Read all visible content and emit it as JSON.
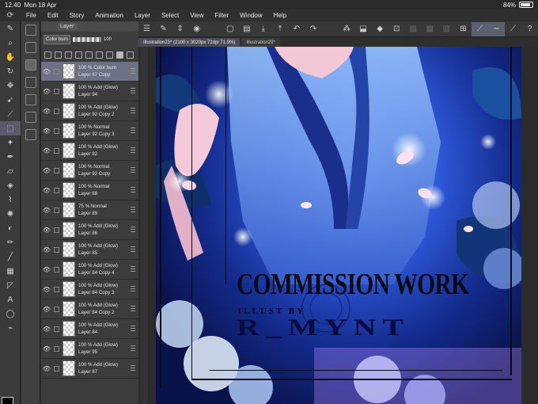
{
  "status_bar": {
    "time": "12.40",
    "date": "Mon 18 Apr",
    "battery": "84%",
    "battery_level": 0.84
  },
  "menu": [
    "File",
    "Edit",
    "Story",
    "Animation",
    "Layer",
    "Select",
    "View",
    "Filter",
    "Window",
    "Help"
  ],
  "layer_panel": {
    "tab_label": "Layer",
    "blend_mode": "Color burn",
    "opacity": "100",
    "layers": [
      {
        "opacity": "100 %",
        "mode": "Color burn",
        "name": "Layer 67 Copy",
        "selected": true
      },
      {
        "opacity": "100 %",
        "mode": "Add (Glow)",
        "name": "Layer 94"
      },
      {
        "opacity": "100 %",
        "mode": "Add (Glow)",
        "name": "Layer 92 Copy 2"
      },
      {
        "opacity": "100 %",
        "mode": "Normal",
        "name": "Layer 92 Copy 3"
      },
      {
        "opacity": "100 %",
        "mode": "Add (Glow)",
        "name": "Layer 92"
      },
      {
        "opacity": "100 %",
        "mode": "Normal",
        "name": "Layer 92 Copy"
      },
      {
        "opacity": "100 %",
        "mode": "Normal",
        "name": "Layer 88"
      },
      {
        "opacity": "75 %",
        "mode": "Normal",
        "name": "Layer 89"
      },
      {
        "opacity": "100 %",
        "mode": "Add (Glow)",
        "name": "Layer 86"
      },
      {
        "opacity": "100 %",
        "mode": "Add (Glow)",
        "name": "Layer 85"
      },
      {
        "opacity": "100 %",
        "mode": "Add (Glow)",
        "name": "Layer 84 Copy 4"
      },
      {
        "opacity": "100 %",
        "mode": "Add (Glow)",
        "name": "Layer 84 Copy 3"
      },
      {
        "opacity": "100 %",
        "mode": "Add (Glow)",
        "name": "Layer 84 Copy 2"
      },
      {
        "opacity": "100 %",
        "mode": "Add (Glow)",
        "name": "Layer 84"
      },
      {
        "opacity": "100 %",
        "mode": "Add (Glow)",
        "name": "Layer 95"
      },
      {
        "opacity": "100 %",
        "mode": "Add (Glow)",
        "name": "Layer 87"
      }
    ]
  },
  "tabs": [
    {
      "label": "Illustration23* (2100 x 3020px 72dpi 71.9%)",
      "active": true
    },
    {
      "label": "Illustration29*",
      "active": false
    }
  ],
  "artwork": {
    "title": "COMMISSION WORK",
    "subtitle": "ILLUST BY",
    "artist": "R_MYNT"
  },
  "colors": {
    "foreground": "#000000",
    "background": "#8a6ff0"
  }
}
